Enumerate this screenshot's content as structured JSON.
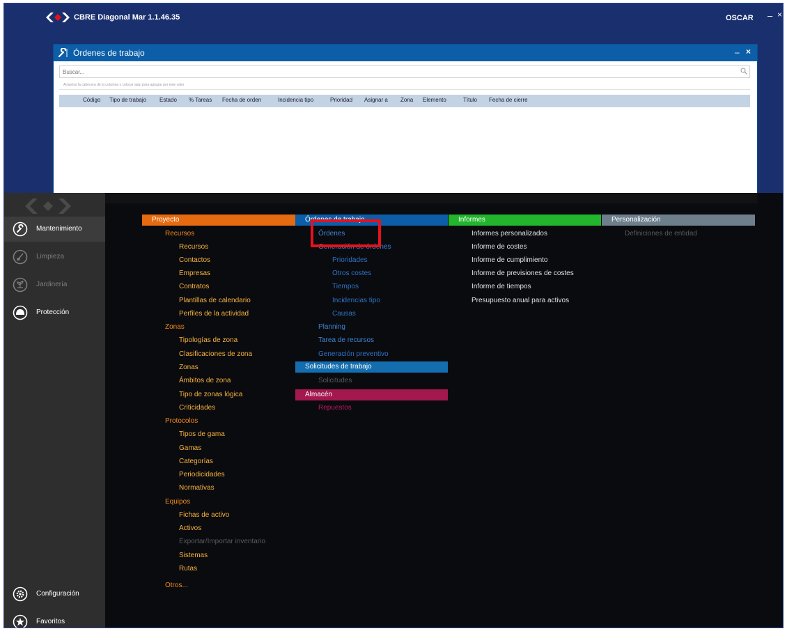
{
  "app": {
    "title": "CBRE Diagonal Mar 1.1.46.35",
    "user": "OSCAR",
    "minimize": "–",
    "close": "×"
  },
  "orders_window": {
    "title": "Órdenes de trabajo",
    "minimize": "–",
    "close": "×",
    "search_placeholder": "Buscar...",
    "group_hint": "Arrastrar la cabecera de la columna y colocar aquí para agrupar por este valor",
    "columns": [
      "Código",
      "Tipo de trabajo",
      "Estado",
      "% Tareas",
      "Fecha de orden",
      "Incidencia tipo",
      "Prioridad",
      "Asignar a",
      "Zona",
      "Elemento",
      "Título",
      "Fecha de cierre"
    ]
  },
  "sidebar": {
    "items": [
      {
        "label": "Mantenimiento",
        "icon": "wrench-icon",
        "active": true
      },
      {
        "label": "Limpieza",
        "icon": "broom-icon",
        "active": false
      },
      {
        "label": "Jardinería",
        "icon": "plant-icon",
        "active": false
      },
      {
        "label": "Protección",
        "icon": "helmet-icon",
        "active": false
      },
      {
        "label": "Configuración",
        "icon": "gear-icon",
        "active": false
      },
      {
        "label": "Favoritos",
        "icon": "star-icon",
        "active": false
      }
    ]
  },
  "menu": {
    "proyecto": {
      "title": "Proyecto",
      "items": [
        "Recursos",
        "Recursos",
        "Contactos",
        "Empresas",
        "Contratos",
        "Plantillas de calendario",
        "Perfiles de la actividad",
        "Zonas",
        "Tipologías de zona",
        "Clasificaciones de zona",
        "Zonas",
        "Ámbitos de zona",
        "Tipo de zonas lógica",
        "Criticidades",
        "Protocolos",
        "Tipos de gama",
        "Gamas",
        "Categorías",
        "Periodicidades",
        "Normativas",
        "Equipos",
        "Fichas de activo",
        "Activos",
        "Exportar/Importar inventario",
        "Sistemas",
        "Rutas",
        "Otros..."
      ]
    },
    "ordenes": {
      "title": "Órdenes de trabajo",
      "items": [
        "Órdenes",
        "Generación de órdenes",
        "Prioridades",
        "Otros costes",
        "Tiempos",
        "Incidencias tipo",
        "Causas",
        "Planning",
        "Tarea de recursos",
        "Generación preventivo"
      ]
    },
    "solicitudes": {
      "title": "Solicitudes de trabajo",
      "items": [
        "Solicitudes"
      ]
    },
    "almacen": {
      "title": "Almacén",
      "items": [
        "Repuestos"
      ]
    },
    "informes": {
      "title": "Informes",
      "items": [
        "Informes personalizados",
        "Informe de costes",
        "Informe de cumplimiento",
        "Informe de previsiones de costes",
        "Informe de tiempos",
        "Presupuesto anual para activos"
      ]
    },
    "personalizacion": {
      "title": "Personalización",
      "items": [
        "Definiciones de entidad"
      ]
    }
  },
  "colors": {
    "app_bg": "#1a2f6e",
    "window_header": "#0d5ea8",
    "proyecto": "#e56a10",
    "ordenes": "#0d5ea8",
    "solicitudes": "#136dae",
    "almacen": "#a3184f",
    "informes": "#22b52d",
    "personalizacion": "#6e7f8c",
    "highlight": "#e5121c"
  }
}
